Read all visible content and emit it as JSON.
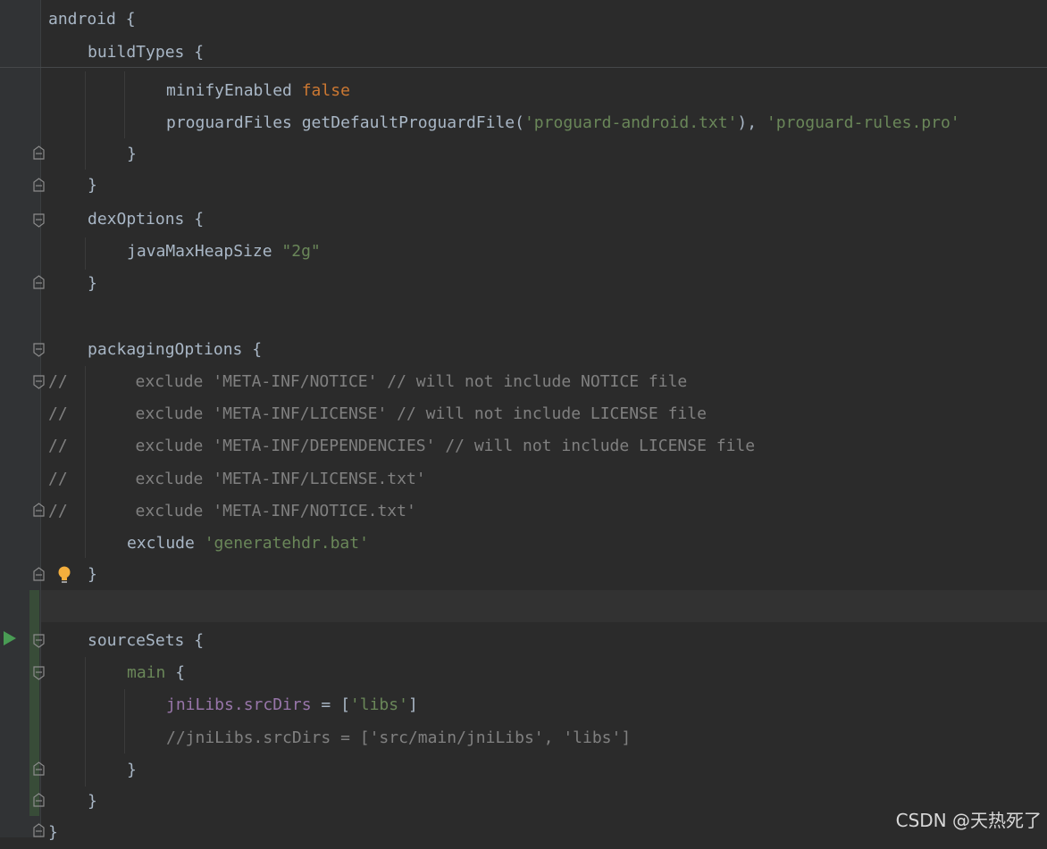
{
  "code_lines": [
    {
      "indent": "",
      "parts": [
        [
          "android ",
          "plain"
        ],
        [
          "{",
          "plain"
        ]
      ]
    },
    {
      "indent": "    ",
      "parts": [
        [
          "buildTypes ",
          "plain"
        ],
        [
          "{",
          "plain"
        ]
      ]
    },
    {
      "indent": "            ",
      "parts": [
        [
          "minifyEnabled ",
          "plain"
        ],
        [
          "false",
          "kw"
        ]
      ]
    },
    {
      "indent": "            ",
      "parts": [
        [
          "proguardFiles getDefaultProguardFile(",
          "plain"
        ],
        [
          "'proguard-android.txt'",
          "str"
        ],
        [
          "), ",
          "plain"
        ],
        [
          "'proguard-rules.pro'",
          "str"
        ]
      ]
    },
    {
      "indent": "        ",
      "parts": [
        [
          "}",
          "plain"
        ]
      ]
    },
    {
      "indent": "    ",
      "parts": [
        [
          "}",
          "plain"
        ]
      ]
    },
    {
      "indent": "    ",
      "parts": [
        [
          "dexOptions ",
          "plain"
        ],
        [
          "{",
          "plain"
        ]
      ]
    },
    {
      "indent": "        ",
      "parts": [
        [
          "javaMaxHeapSize ",
          "plain"
        ],
        [
          "\"2g\"",
          "str"
        ]
      ]
    },
    {
      "indent": "    ",
      "parts": [
        [
          "}",
          "plain"
        ]
      ]
    },
    {
      "indent": "",
      "parts": []
    },
    {
      "indent": "    ",
      "parts": [
        [
          "packagingOptions ",
          "plain"
        ],
        [
          "{",
          "plain"
        ]
      ]
    },
    {
      "indent": "",
      "parts": [
        [
          "//       exclude 'META-INF/NOTICE' // will not include NOTICE file",
          "cm"
        ]
      ]
    },
    {
      "indent": "",
      "parts": [
        [
          "//       exclude 'META-INF/LICENSE' // will not include LICENSE file",
          "cm"
        ]
      ]
    },
    {
      "indent": "",
      "parts": [
        [
          "//       exclude 'META-INF/DEPENDENCIES' // will not include LICENSE file",
          "cm"
        ]
      ]
    },
    {
      "indent": "",
      "parts": [
        [
          "//       exclude 'META-INF/LICENSE.txt'",
          "cm"
        ]
      ]
    },
    {
      "indent": "",
      "parts": [
        [
          "//       exclude 'META-INF/NOTICE.txt'",
          "cm"
        ]
      ]
    },
    {
      "indent": "        ",
      "parts": [
        [
          "exclude ",
          "plain"
        ],
        [
          "'generatehdr.bat'",
          "str"
        ]
      ]
    },
    {
      "indent": "    ",
      "parts": [
        [
          "}",
          "plain"
        ]
      ]
    },
    {
      "indent": "",
      "parts": []
    },
    {
      "indent": "    ",
      "parts": [
        [
          "sourceSets ",
          "plain"
        ],
        [
          "{",
          "plain"
        ]
      ]
    },
    {
      "indent": "        ",
      "parts": [
        [
          "main ",
          "grn"
        ],
        [
          "{",
          "plain"
        ]
      ]
    },
    {
      "indent": "            ",
      "parts": [
        [
          "jniLibs.srcDirs",
          "prop"
        ],
        [
          " = [",
          "plain"
        ],
        [
          "'libs'",
          "str"
        ],
        [
          "]",
          "plain"
        ]
      ]
    },
    {
      "indent": "            ",
      "parts": [
        [
          "//jniLibs.srcDirs = ['src/main/jniLibs', 'libs']",
          "cm"
        ]
      ]
    },
    {
      "indent": "        ",
      "parts": [
        [
          "}",
          "plain"
        ]
      ]
    },
    {
      "indent": "    ",
      "parts": [
        [
          "}",
          "plain"
        ]
      ]
    },
    {
      "indent": "",
      "parts": [
        [
          "}",
          "plain"
        ]
      ]
    }
  ],
  "watermark": "CSDN @天热死了",
  "icons": {
    "run": "run-gutter-icon",
    "bulb": "intention-bulb-icon",
    "fold": "fold-marker-icon"
  },
  "colors": {
    "background": "#2b2b2b",
    "keyword": "#cc7832",
    "string": "#6a8759",
    "comment": "#808080",
    "property": "#9876aa",
    "text": "#a9b7c6"
  }
}
